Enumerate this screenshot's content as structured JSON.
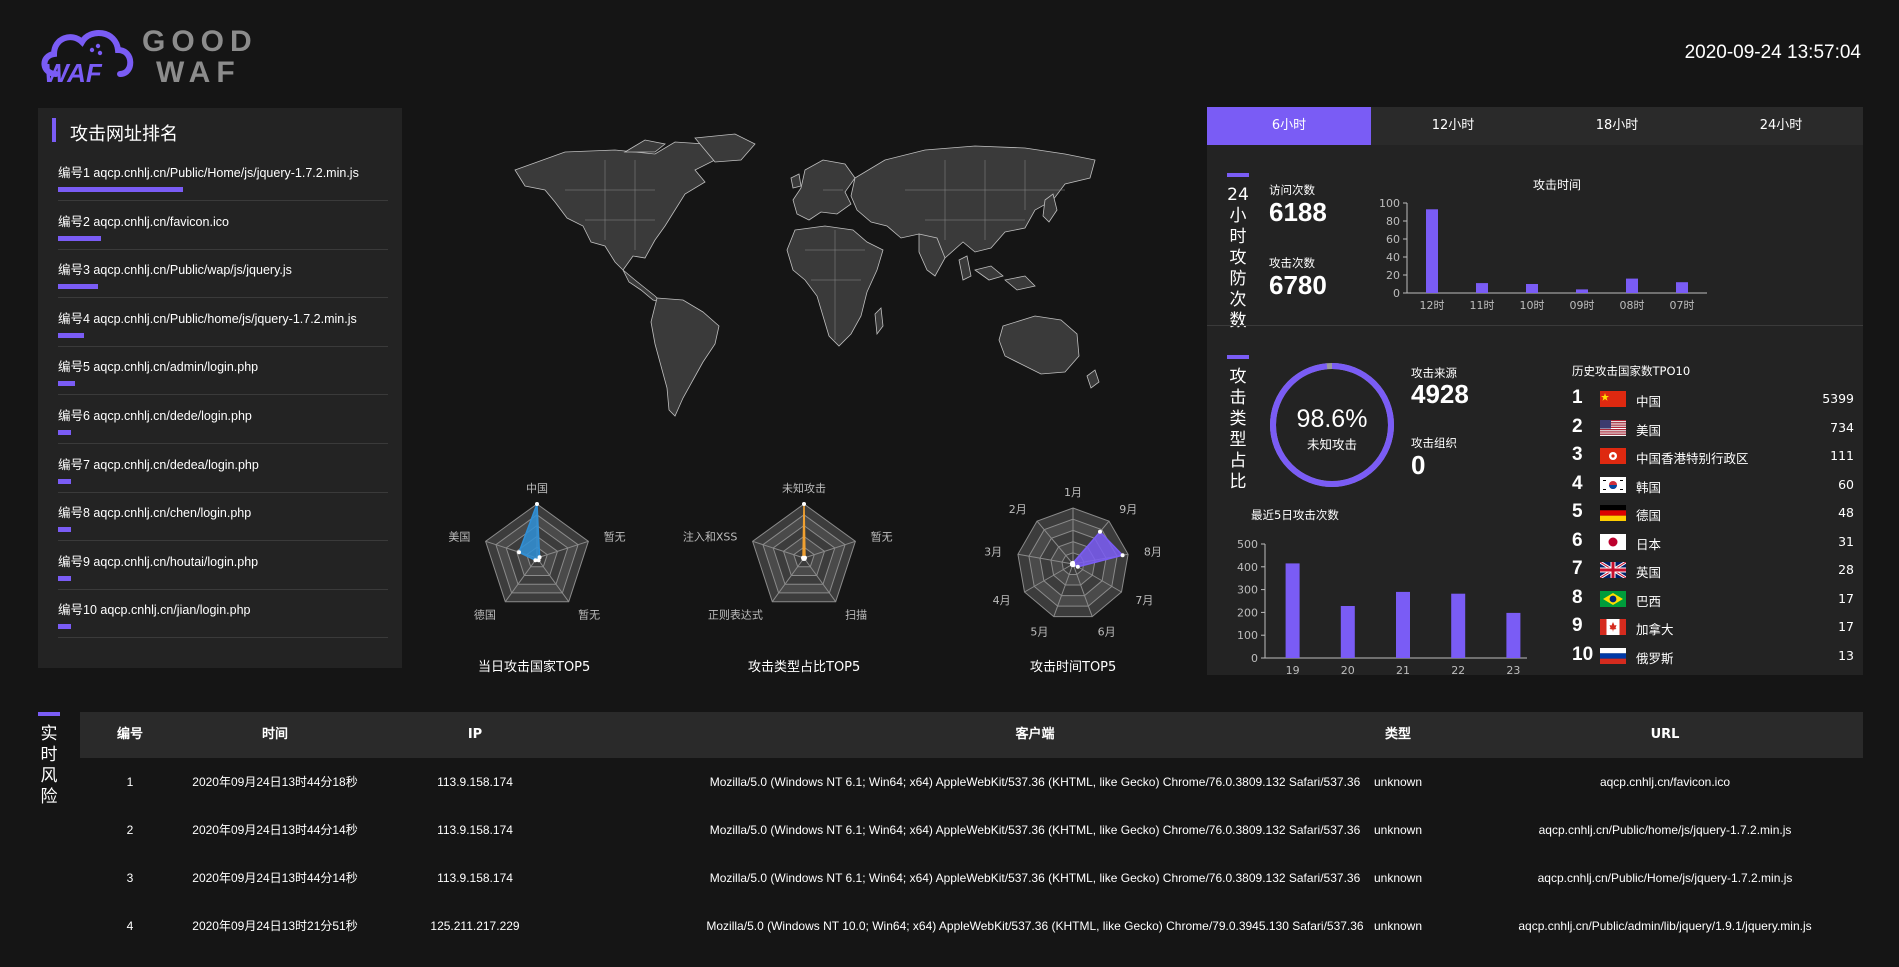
{
  "header": {
    "logo_text": "WAF",
    "brand_line1": "GOOD",
    "brand_line2": "WAF",
    "datetime": "2020-09-24 13:57:04"
  },
  "left_panel": {
    "title": "攻击网址排名",
    "items": [
      {
        "label": "编号1  aqcp.cnhlj.cn/Public/Home/js/jquery-1.7.2.min.js",
        "share": 0.38
      },
      {
        "label": "编号2  aqcp.cnhlj.cn/favicon.ico",
        "share": 0.13
      },
      {
        "label": "编号3  aqcp.cnhlj.cn/Public/wap/js/jquery.js",
        "share": 0.12
      },
      {
        "label": "编号4  aqcp.cnhlj.cn/Public/home/js/jquery-1.7.2.min.js",
        "share": 0.08
      },
      {
        "label": "编号5  aqcp.cnhlj.cn/admin/login.php",
        "share": 0.05
      },
      {
        "label": "编号6  aqcp.cnhlj.cn/dede/login.php",
        "share": 0.04
      },
      {
        "label": "编号7  aqcp.cnhlj.cn/dedea/login.php",
        "share": 0.04
      },
      {
        "label": "编号8  aqcp.cnhlj.cn/chen/login.php",
        "share": 0.04
      },
      {
        "label": "编号9  aqcp.cnhlj.cn/houtai/login.php",
        "share": 0.04
      },
      {
        "label": "编号10  aqcp.cnhlj.cn/jian/login.php",
        "share": 0.04
      }
    ]
  },
  "colors": {
    "accent": "#7a5cf5",
    "country_radar": "#2f8fd6",
    "type_radar": "#f0a030"
  },
  "radars": {
    "country": {
      "caption": "当日攻击国家TOP5",
      "indicators": [
        "中国",
        "暂无",
        "暂无",
        "德国",
        "美国"
      ],
      "values": [
        1.0,
        0.05,
        0.05,
        0.05,
        0.35
      ]
    },
    "type": {
      "caption": "攻击类型占比TOP5",
      "indicators": [
        "未知攻击",
        "暂无",
        "扫描",
        "正则表达式",
        "注入和XSS"
      ],
      "values": [
        1.0,
        0.02,
        0.02,
        0.02,
        0.02
      ]
    },
    "time": {
      "caption": "攻击时间TOP5",
      "indicators": [
        "1月",
        "9月",
        "8月",
        "7月",
        "6月",
        "5月",
        "4月",
        "3月",
        "2月"
      ],
      "values": [
        0.02,
        0.75,
        0.9,
        0.1,
        0.02,
        0.02,
        0.02,
        0.02,
        0.02
      ]
    }
  },
  "tabs": [
    {
      "label": "6小时",
      "active": true
    },
    {
      "label": "12小时",
      "active": false
    },
    {
      "label": "18小时",
      "active": false
    },
    {
      "label": "24小时",
      "active": false
    }
  ],
  "attack_defense": {
    "title": "24小时攻防次数",
    "visits_label": "访问次数",
    "visits_value": "6188",
    "attacks_label": "攻击次数",
    "attacks_value": "6780"
  },
  "attack_types": {
    "title": "攻击类型占比",
    "donut_percent": "98.6%",
    "donut_fraction": 0.986,
    "donut_label": "未知攻击",
    "source_label": "攻击来源",
    "source_value": "4928",
    "org_label": "攻击组织",
    "org_value": "0"
  },
  "country_top10": {
    "title": "历史攻击国家数TPO10",
    "rows": [
      {
        "rank": "1",
        "flag": "cn",
        "name": "中国",
        "count": "5399"
      },
      {
        "rank": "2",
        "flag": "us",
        "name": "美国",
        "count": "734"
      },
      {
        "rank": "3",
        "flag": "hk",
        "name": "中国香港特别行政区",
        "count": "111"
      },
      {
        "rank": "4",
        "flag": "kr",
        "name": "韩国",
        "count": "60"
      },
      {
        "rank": "5",
        "flag": "de",
        "name": "德国",
        "count": "48"
      },
      {
        "rank": "6",
        "flag": "jp",
        "name": "日本",
        "count": "31"
      },
      {
        "rank": "7",
        "flag": "gb",
        "name": "英国",
        "count": "28"
      },
      {
        "rank": "8",
        "flag": "br",
        "name": "巴西",
        "count": "17"
      },
      {
        "rank": "9",
        "flag": "ca",
        "name": "加拿大",
        "count": "17"
      },
      {
        "rank": "10",
        "flag": "ru",
        "name": "俄罗斯",
        "count": "13"
      }
    ]
  },
  "chart_data": [
    {
      "type": "bar",
      "title": "攻击时间",
      "categories": [
        "12时",
        "11时",
        "10时",
        "09时",
        "08时",
        "07时"
      ],
      "values": [
        93,
        11,
        10,
        4,
        16,
        12
      ],
      "ylim": [
        0,
        100
      ],
      "yticks": [
        0,
        20,
        40,
        60,
        80,
        100
      ],
      "grid": false
    },
    {
      "type": "bar",
      "title": "最近5日攻击次数",
      "categories": [
        "19",
        "20",
        "21",
        "22",
        "23"
      ],
      "values": [
        415,
        228,
        290,
        282,
        198
      ],
      "ylim": [
        0,
        500
      ],
      "yticks": [
        0,
        100,
        200,
        300,
        400,
        500
      ],
      "grid": false
    }
  ],
  "risk_table": {
    "title": "实时风险",
    "columns": [
      "编号",
      "时间",
      "IP",
      "客户端",
      "类型",
      "URL"
    ],
    "rows": [
      [
        "1",
        "2020年09月24日13时44分18秒",
        "113.9.158.174",
        "Mozilla/5.0 (Windows NT 6.1; Win64; x64) AppleWebKit/537.36 (KHTML, like Gecko) Chrome/76.0.3809.132 Safari/537.36",
        "unknown",
        "aqcp.cnhlj.cn/favicon.ico"
      ],
      [
        "2",
        "2020年09月24日13时44分14秒",
        "113.9.158.174",
        "Mozilla/5.0 (Windows NT 6.1; Win64; x64) AppleWebKit/537.36 (KHTML, like Gecko) Chrome/76.0.3809.132 Safari/537.36",
        "unknown",
        "aqcp.cnhlj.cn/Public/home/js/jquery-1.7.2.min.js"
      ],
      [
        "3",
        "2020年09月24日13时44分14秒",
        "113.9.158.174",
        "Mozilla/5.0 (Windows NT 6.1; Win64; x64) AppleWebKit/537.36 (KHTML, like Gecko) Chrome/76.0.3809.132 Safari/537.36",
        "unknown",
        "aqcp.cnhlj.cn/Public/Home/js/jquery-1.7.2.min.js"
      ],
      [
        "4",
        "2020年09月24日13时21分51秒",
        "125.211.217.229",
        "Mozilla/5.0 (Windows NT 10.0; Win64; x64) AppleWebKit/537.36 (KHTML, like Gecko) Chrome/79.0.3945.130 Safari/537.36",
        "unknown",
        "aqcp.cnhlj.cn/Public/admin/lib/jquery/1.9.1/jquery.min.js"
      ]
    ]
  }
}
